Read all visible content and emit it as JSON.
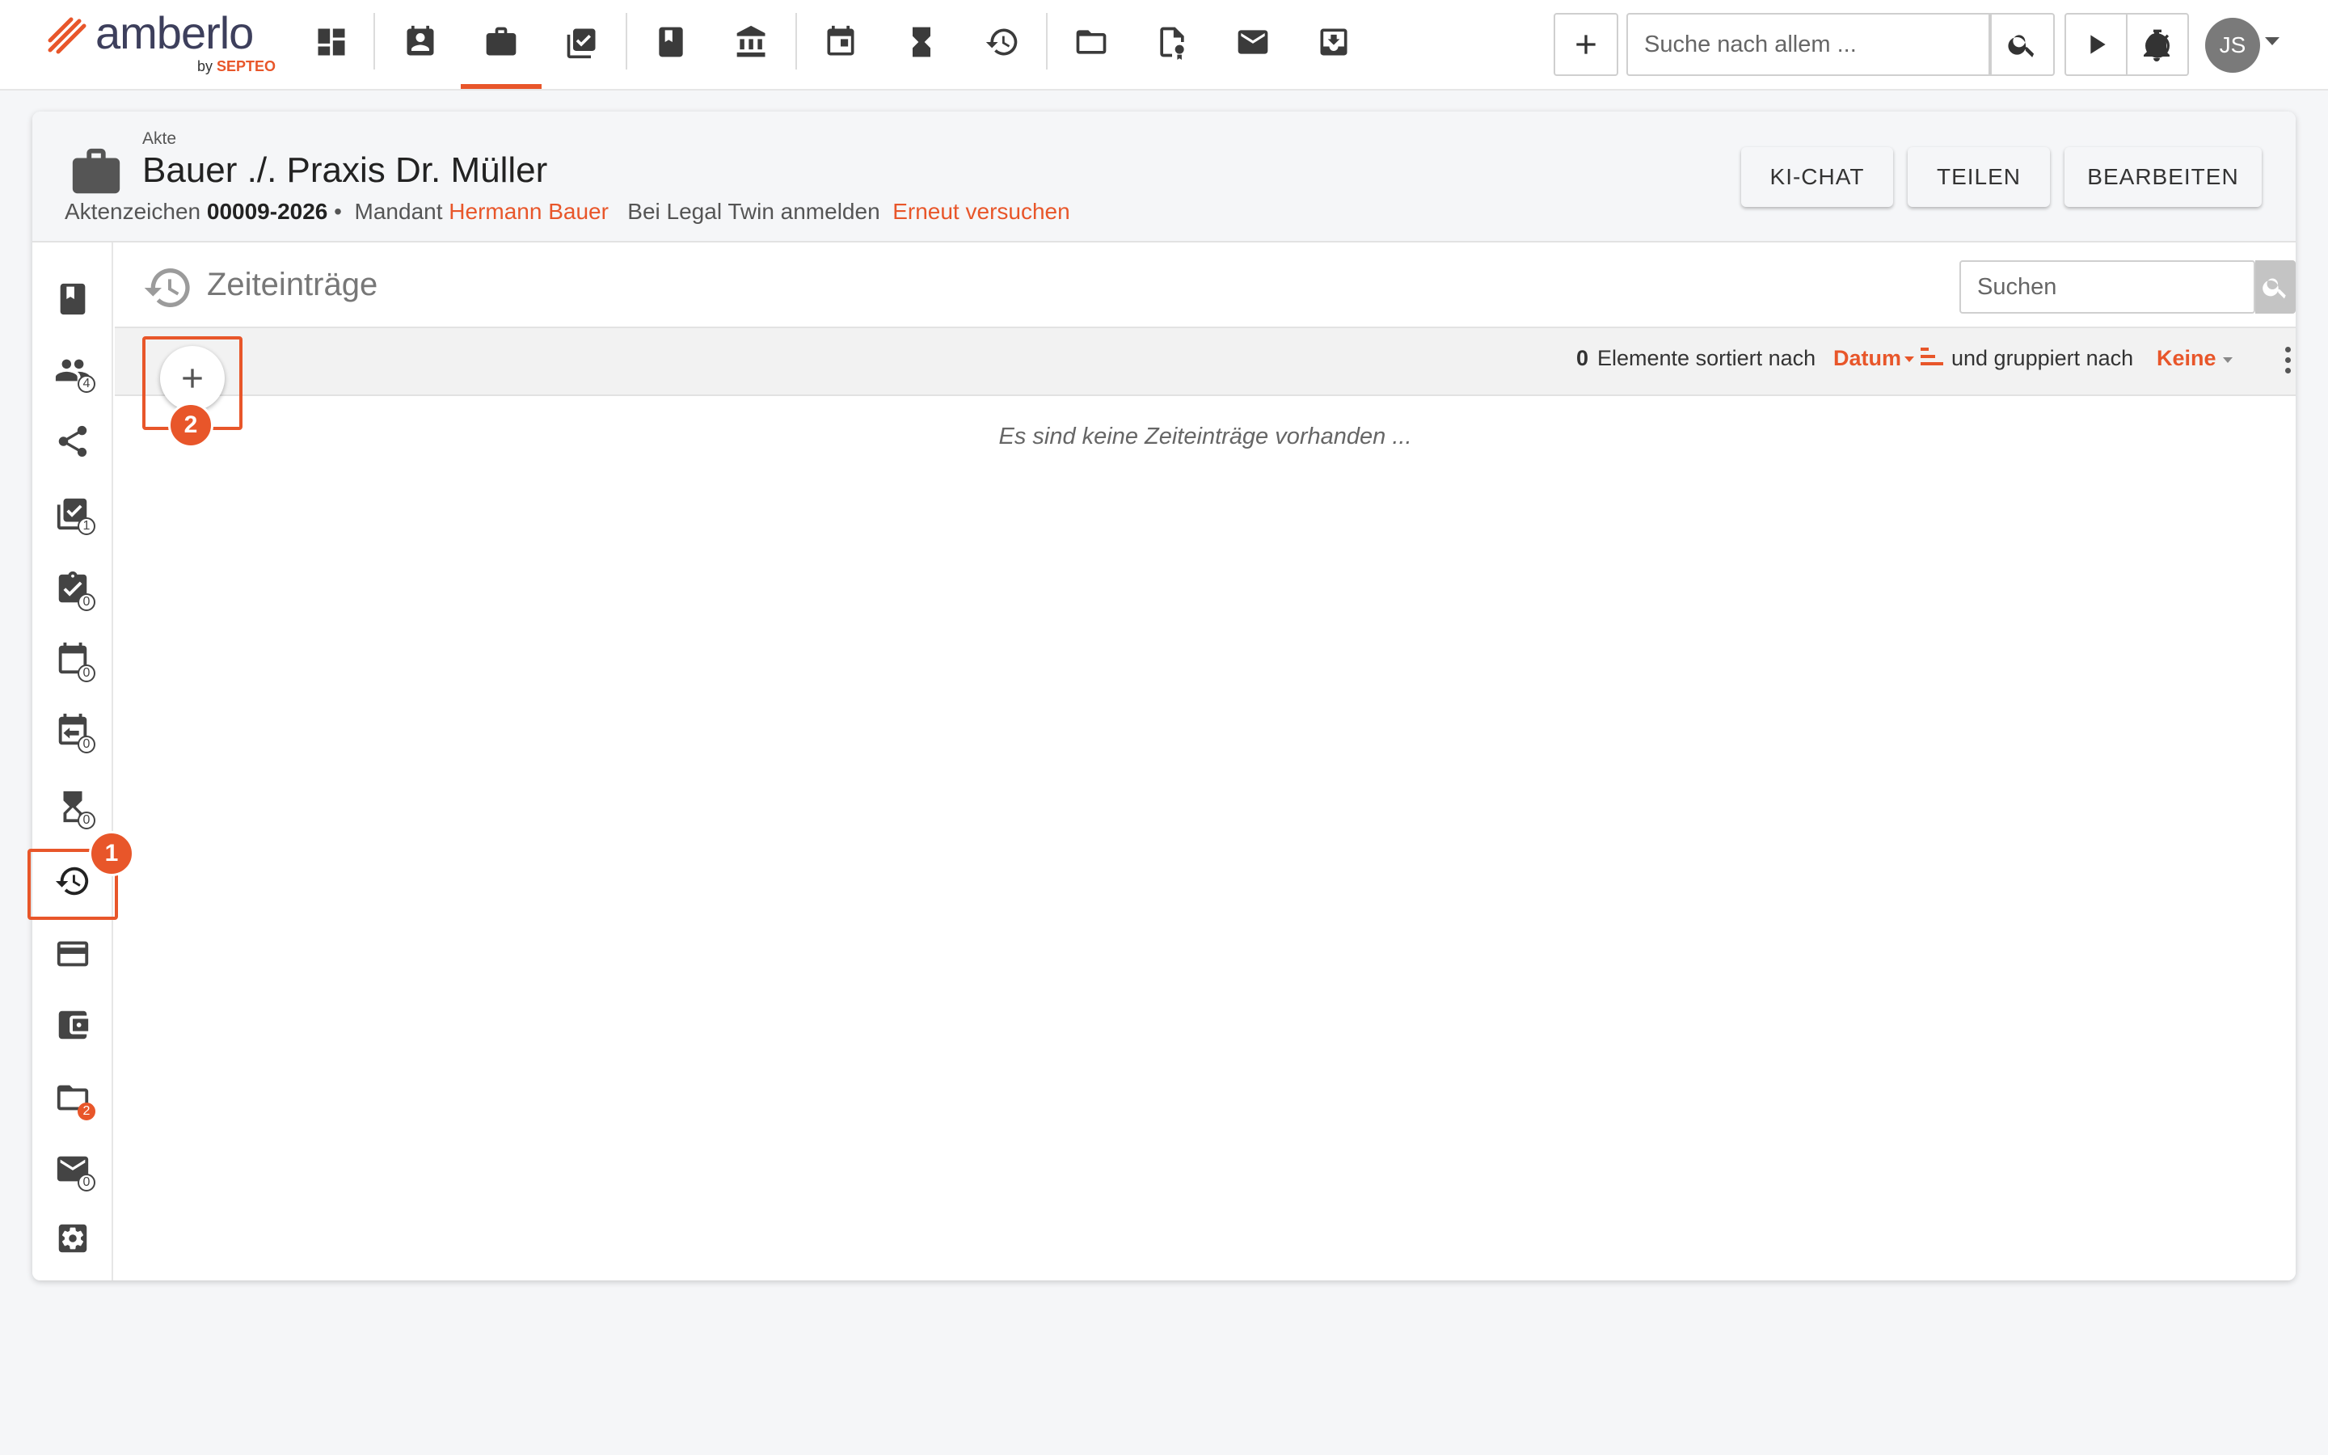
{
  "brand": {
    "name": "amberlo",
    "by": "by",
    "by_brand": "SEPTEO"
  },
  "colors": {
    "accent": "#e8562a",
    "icon": "#3b3b3b",
    "muted": "#9b9b9b"
  },
  "nav": {
    "icons": [
      "dashboard-icon",
      "contacts-icon",
      "briefcase-icon",
      "tasks-icon",
      "book-icon",
      "institution-icon",
      "calendar-icon",
      "hourglass-icon",
      "time-billing-icon",
      "folder-icon",
      "document-badge-icon",
      "mail-icon",
      "inbox-download-icon"
    ],
    "active": "briefcase-icon"
  },
  "topbar": {
    "add_label": "+",
    "search_placeholder": "Suche nach allem ...",
    "avatar_initials": "JS"
  },
  "case": {
    "type_label": "Akte",
    "title": "Bauer ./. Praxis Dr. Müller",
    "aktenzeichen_label": "Aktenzeichen",
    "aktenzeichen_value": "00009-2026",
    "separator": "•",
    "mandant_label": "Mandant",
    "mandant_value": "Hermann Bauer",
    "legal_twin_text": "Bei Legal Twin anmelden",
    "retry_link": "Erneut versuchen"
  },
  "header_buttons": {
    "chat": "KI-CHAT",
    "share": "TEILEN",
    "edit": "BEARBEITEN"
  },
  "sidebar": {
    "items": [
      {
        "icon": "book-icon",
        "badge": ""
      },
      {
        "icon": "people-icon",
        "badge": "4"
      },
      {
        "icon": "share-icon",
        "badge": ""
      },
      {
        "icon": "tasks-icon",
        "badge": "1"
      },
      {
        "icon": "clipboard-check-icon",
        "badge": "0"
      },
      {
        "icon": "calendar-icon",
        "badge": "0"
      },
      {
        "icon": "calendar-return-icon",
        "badge": "0"
      },
      {
        "icon": "hourglass-icon",
        "badge": "0"
      },
      {
        "icon": "time-billing-icon",
        "badge": ""
      },
      {
        "icon": "credit-card-icon",
        "badge": ""
      },
      {
        "icon": "wallet-icon",
        "badge": ""
      },
      {
        "icon": "folder-icon",
        "badge": "2"
      },
      {
        "icon": "mail-icon",
        "badge": "0"
      },
      {
        "icon": "settings-icon",
        "badge": ""
      }
    ],
    "active_index": 8
  },
  "section": {
    "title": "Zeiteinträge",
    "search_placeholder": "Suchen",
    "count": "0",
    "sorted_by_text": "Elemente sortiert nach",
    "sort_field": "Datum",
    "grouped_by_text": "und gruppiert nach",
    "group_field": "Keine",
    "empty_message": "Es sind keine Zeiteinträge vorhanden ..."
  },
  "annotations": {
    "step1": "1",
    "step2": "2"
  }
}
